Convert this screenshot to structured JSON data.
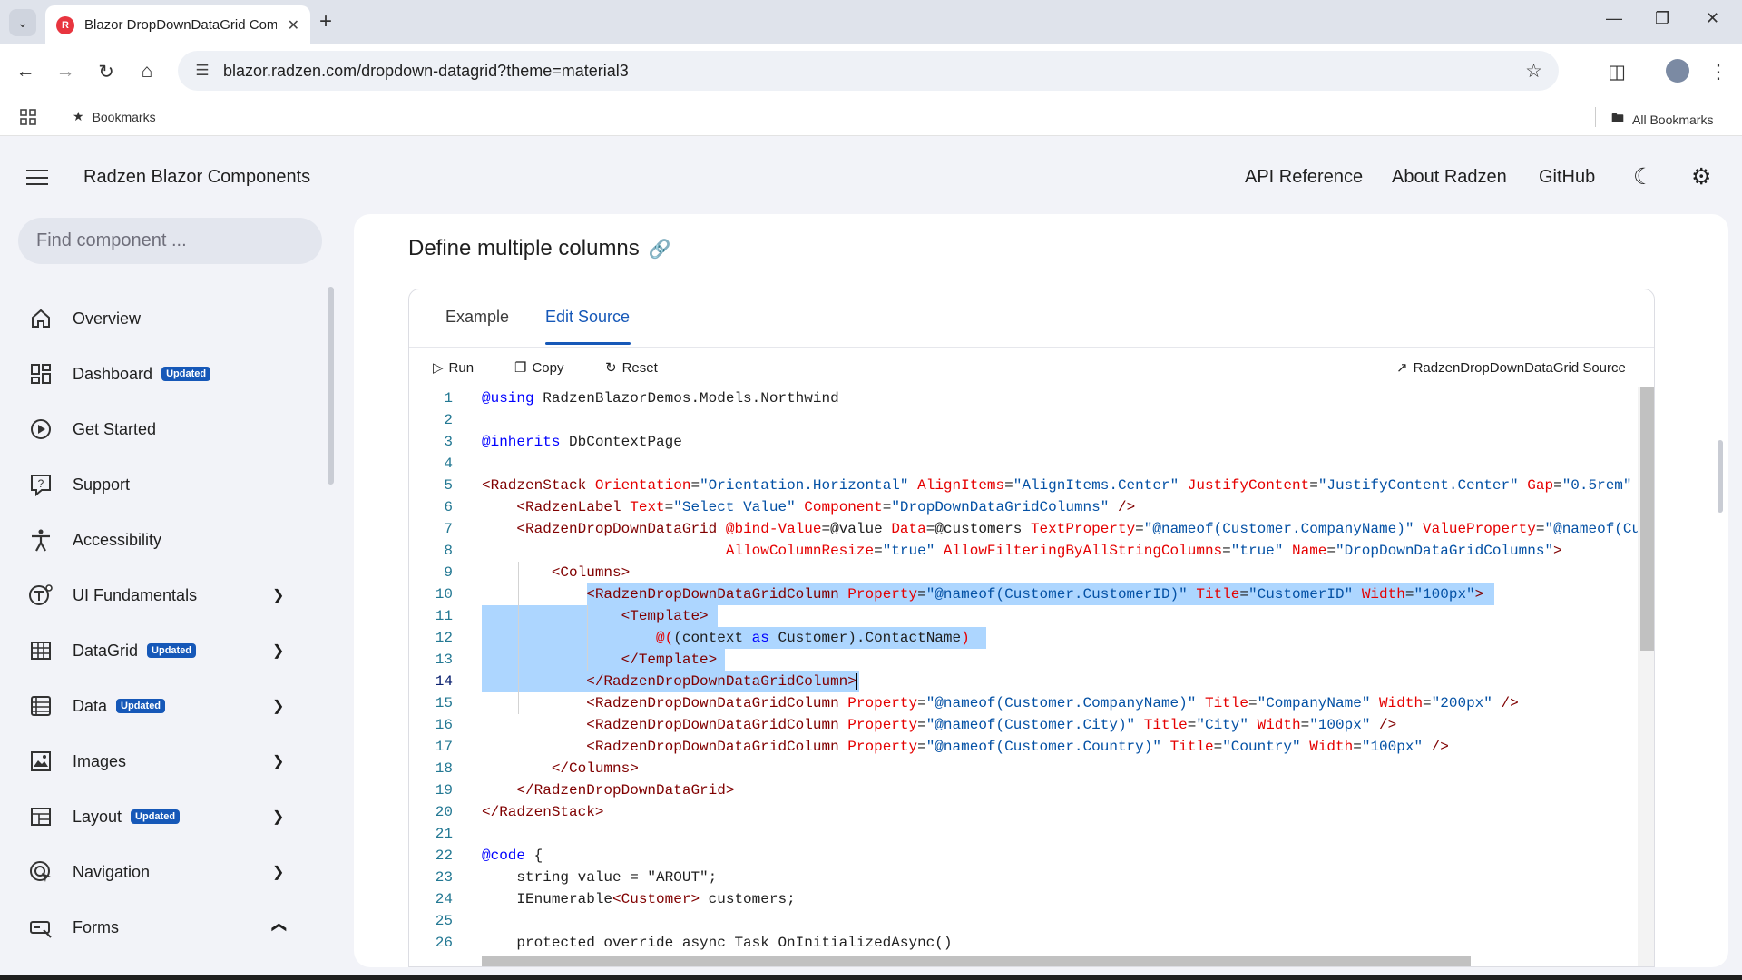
{
  "browser": {
    "tab_title": "Blazor DropDownDataGrid Com",
    "url": "blazor.radzen.com/dropdown-datagrid?theme=material3",
    "bookmarks_label": "Bookmarks",
    "all_bookmarks_label": "All Bookmarks"
  },
  "header": {
    "app_title": "Radzen Blazor Components",
    "links": [
      "API Reference",
      "About Radzen",
      "GitHub"
    ]
  },
  "sidebar": {
    "search_placeholder": "Find component ...",
    "badge_text": "Updated",
    "items": [
      {
        "label": "Overview",
        "icon": "home-icon"
      },
      {
        "label": "Dashboard",
        "icon": "dashboard-icon",
        "badge": true
      },
      {
        "label": "Get Started",
        "icon": "play-circle-icon"
      },
      {
        "label": "Support",
        "icon": "help-icon"
      },
      {
        "label": "Accessibility",
        "icon": "accessibility-icon"
      },
      {
        "label": "UI Fundamentals",
        "icon": "text-icon",
        "expandable": true
      },
      {
        "label": "DataGrid",
        "icon": "grid-icon",
        "badge": true,
        "expandable": true
      },
      {
        "label": "Data",
        "icon": "list-icon",
        "badge": true,
        "expandable": true
      },
      {
        "label": "Images",
        "icon": "image-icon",
        "expandable": true
      },
      {
        "label": "Layout",
        "icon": "layout-icon",
        "badge": true,
        "expandable": true
      },
      {
        "label": "Navigation",
        "icon": "navigation-icon",
        "expandable": true
      },
      {
        "label": "Forms",
        "icon": "forms-icon",
        "expanded": true
      }
    ]
  },
  "main": {
    "section_title": "Define multiple columns",
    "tabs": [
      "Example",
      "Edit Source"
    ],
    "active_tab": "Edit Source",
    "actions": {
      "run": "Run",
      "copy": "Copy",
      "reset": "Reset",
      "source": "RadzenDropDownDataGrid Source"
    }
  },
  "code": {
    "line_numbers": [
      "1",
      "2",
      "3",
      "4",
      "5",
      "6",
      "7",
      "8",
      "9",
      "10",
      "11",
      "12",
      "13",
      "14",
      "15",
      "16",
      "17",
      "18",
      "19",
      "20",
      "21",
      "22",
      "23",
      "24",
      "25",
      "26"
    ],
    "current_line": "14"
  }
}
